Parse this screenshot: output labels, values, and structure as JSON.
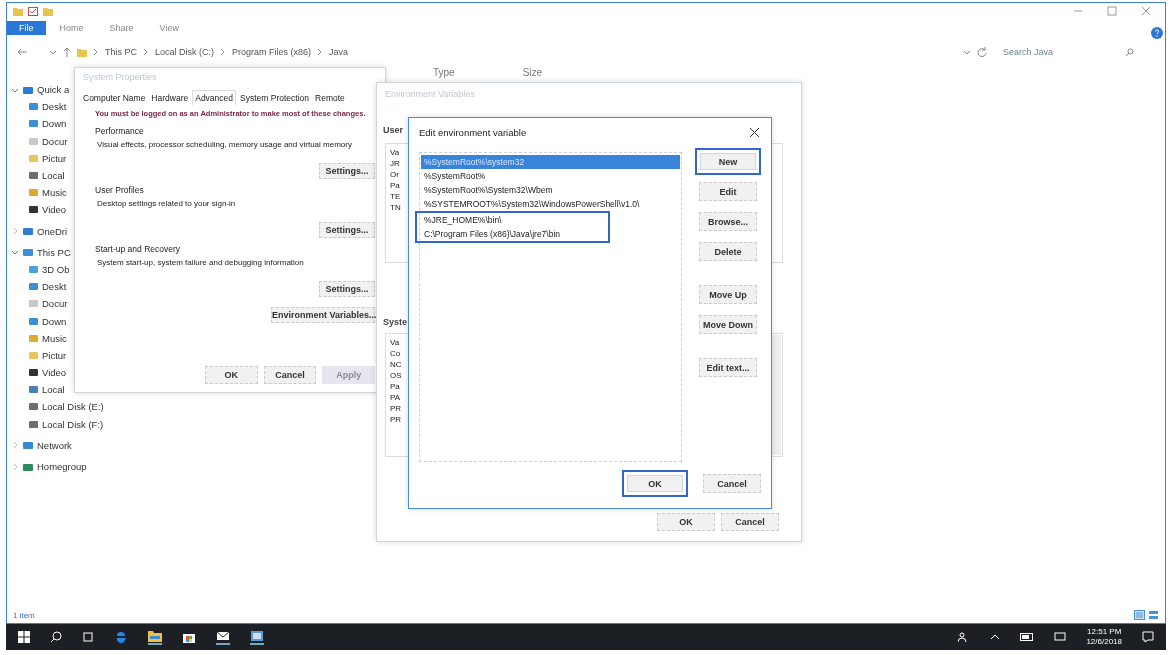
{
  "explorer": {
    "ribbon_tabs": [
      {
        "label": "File",
        "selected": true
      },
      {
        "label": "Home",
        "selected": false
      },
      {
        "label": "Share",
        "selected": false
      },
      {
        "label": "View",
        "selected": false
      }
    ],
    "breadcrumb": [
      "This PC",
      "Local Disk (C:)",
      "Program Files (x86)",
      "Java"
    ],
    "search": {
      "placeholder": "Search Java"
    },
    "columns": [
      "Type",
      "Size"
    ],
    "nav": [
      {
        "label": "Quick a",
        "kind": "star",
        "expanded": true,
        "children": [
          {
            "label": "Deskt",
            "kind": "desktop"
          },
          {
            "label": "Down",
            "kind": "download"
          },
          {
            "label": "Docur",
            "kind": "documents"
          },
          {
            "label": "Pictur",
            "kind": "pictures"
          },
          {
            "label": "Local",
            "kind": "drive"
          },
          {
            "label": "Music",
            "kind": "music"
          },
          {
            "label": "Video",
            "kind": "video"
          }
        ]
      },
      {
        "label": "OneDri",
        "kind": "cloud",
        "expanded": false
      },
      {
        "label": "This PC",
        "kind": "pc",
        "expanded": true,
        "children": [
          {
            "label": "3D Ob",
            "kind": "objects"
          },
          {
            "label": "Deskt",
            "kind": "desktop"
          },
          {
            "label": "Docur",
            "kind": "documents"
          },
          {
            "label": "Down",
            "kind": "download"
          },
          {
            "label": "Music",
            "kind": "music"
          },
          {
            "label": "Pictur",
            "kind": "pictures"
          },
          {
            "label": "Video",
            "kind": "video"
          },
          {
            "label": "Local",
            "kind": "system-drive"
          },
          {
            "label": "Local Disk (E:)",
            "kind": "drive"
          },
          {
            "label": "Local Disk (F:)",
            "kind": "drive"
          }
        ]
      },
      {
        "label": "Network",
        "kind": "network",
        "expanded": false
      },
      {
        "label": "Homegroup",
        "kind": "homegroup",
        "expanded": false
      }
    ],
    "status_bar": "1 item"
  },
  "system_properties": {
    "title": "System Properties",
    "tabs": [
      {
        "label": "Computer Name",
        "selected": false
      },
      {
        "label": "Hardware",
        "selected": false
      },
      {
        "label": "Advanced",
        "selected": true
      },
      {
        "label": "System Protection",
        "selected": false
      },
      {
        "label": "Remote",
        "selected": false
      }
    ],
    "warning": "You must be logged on as an Administrator to make most of these changes.",
    "sections": [
      {
        "heading": "Performance",
        "description": "Visual effects, processor scheduling, memory usage and virtual memory",
        "button": "Settings..."
      },
      {
        "heading": "User Profiles",
        "description": "Desktop settings related to your sign-in",
        "button": "Settings..."
      },
      {
        "heading": "Start-up and Recovery",
        "description": "System start-up, system failure and debugging information",
        "button": "Settings..."
      }
    ],
    "env_button": "Environment Variables...",
    "buttons": [
      {
        "label": "OK",
        "disabled": false
      },
      {
        "label": "Cancel",
        "disabled": false
      },
      {
        "label": "Apply",
        "disabled": true
      }
    ]
  },
  "environment_variables": {
    "title": "Environment Variables",
    "user_label": "User",
    "user_rows": [
      "Va",
      "JR",
      "Or",
      "Pa",
      "TE",
      "TN"
    ],
    "system_label": "Syste",
    "system_rows": [
      "Va",
      "Co",
      "NC",
      "OS",
      "Pa",
      "PA",
      "PR",
      "PR"
    ],
    "buttons": [
      "OK",
      "Cancel"
    ]
  },
  "edit_dialog": {
    "title": "Edit environment variable",
    "entries": [
      {
        "text": "%SystemRoot%\\system32",
        "selected": true,
        "highlighted": false
      },
      {
        "text": "%SystemRoot%",
        "selected": false,
        "highlighted": false
      },
      {
        "text": "%SystemRoot%\\System32\\Wbem",
        "selected": false,
        "highlighted": false
      },
      {
        "text": "%SYSTEMROOT%\\System32\\WindowsPowerShell\\v1.0\\",
        "selected": false,
        "highlighted": false
      },
      {
        "text": "%JRE_HOME%\\bin\\",
        "selected": false,
        "highlighted": true
      },
      {
        "text": "C:\\Program Files (x86)\\Java\\jre7\\bin",
        "selected": false,
        "highlighted": true
      }
    ],
    "buttons": [
      {
        "label": "New",
        "highlighted": true
      },
      {
        "label": "Edit",
        "highlighted": false
      },
      {
        "label": "Browse...",
        "highlighted": false
      },
      {
        "label": "Delete",
        "highlighted": false
      },
      {
        "label": "Move Up",
        "highlighted": false
      },
      {
        "label": "Move Down",
        "highlighted": false
      },
      {
        "label": "Edit text...",
        "highlighted": false
      }
    ],
    "footer_buttons": [
      {
        "label": "OK",
        "highlighted": true
      },
      {
        "label": "Cancel",
        "highlighted": false
      }
    ]
  },
  "taskbar": {
    "time": "12:51 PM",
    "date": "12/6/2018"
  }
}
